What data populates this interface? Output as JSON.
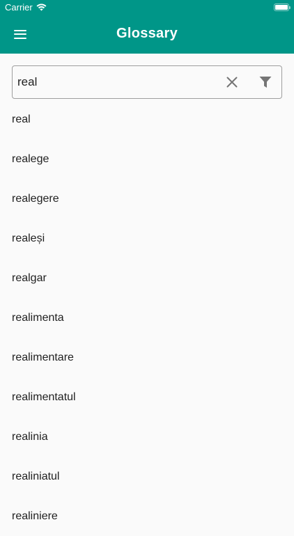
{
  "status_bar": {
    "carrier": "Carrier",
    "wifi_icon": "wifi-icon",
    "battery_icon": "battery-icon"
  },
  "app_bar": {
    "menu_icon": "hamburger-menu-icon",
    "title": "Glossary",
    "color": "#009688"
  },
  "search": {
    "value": "real",
    "placeholder": "",
    "clear_icon": "close-icon",
    "filter_icon": "filter-icon"
  },
  "words": [
    "real",
    "realege",
    "realegere",
    "realeși",
    "realgar",
    "realimenta",
    "realimentare",
    "realimentatul",
    "realinia",
    "realiniatul",
    "realiniere"
  ]
}
